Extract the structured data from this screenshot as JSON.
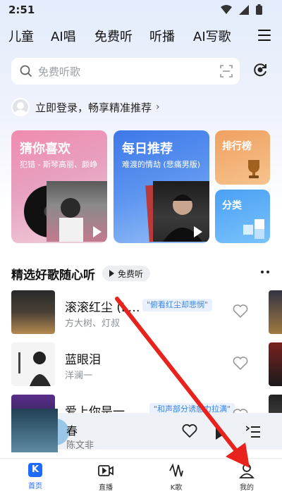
{
  "status_bar": {
    "time": "2:51"
  },
  "top_tabs": [
    "儿童",
    "AI唱",
    "免费听",
    "听播",
    "AI写歌"
  ],
  "search": {
    "placeholder": "免费听歌"
  },
  "login": {
    "text": "立即登录，畅享精准推荐",
    "chevron": "›"
  },
  "cards": {
    "guess": {
      "title": "猜你喜欢",
      "subtitle": "犯错 - 斯琴高丽、颜峥"
    },
    "daily": {
      "title": "每日推荐",
      "subtitle": "难渡的情劫 (悲痛男版)"
    },
    "rank": {
      "title": "排行榜"
    },
    "category": {
      "title": "分类"
    }
  },
  "section": {
    "title": "精选好歌随心听",
    "free_label": "免费听"
  },
  "songs": [
    {
      "title": "滚滚红尘 (L…",
      "artist": "方大树、灯叔",
      "tag": "\"俯看红尘却悲悯\""
    },
    {
      "title": "蓝眼泪",
      "artist": "洋澜一",
      "tag": ""
    },
    {
      "title": "爱上你是一…",
      "artist": "",
      "tag": "\"和声部分诱惑力拉满\""
    }
  ],
  "mini_player": {
    "title": "春",
    "artist": "陈文非"
  },
  "bottom_nav": [
    {
      "label": "首页",
      "icon": "home-k-icon"
    },
    {
      "label": "直播",
      "icon": "live-video-icon"
    },
    {
      "label": "K歌",
      "icon": "k-song-wave-icon"
    },
    {
      "label": "我的",
      "icon": "profile-icon"
    }
  ],
  "colors": {
    "accent": "#1f6bff",
    "tag_text": "#3b82e0",
    "annotation_arrow": "#e8231d"
  }
}
